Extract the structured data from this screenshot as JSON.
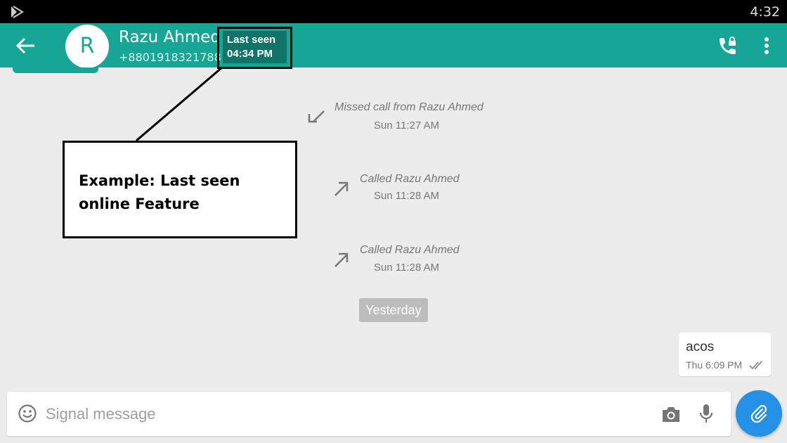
{
  "status_bar": {
    "time": "4:32",
    "icon": "play-store-icon"
  },
  "app_bar": {
    "background_color": "#17a595",
    "avatar_initial": "R",
    "contact_name": "Razu Ahmed",
    "contact_phone": "+8801918321788",
    "last_seen_label": "Last seen",
    "last_seen_time": "04:34 PM",
    "icons": [
      "back-arrow-icon",
      "phone-lock-icon",
      "more-vert-icon"
    ]
  },
  "messages": {
    "call_entries": [
      {
        "type": "missed",
        "icon": "missed-call-icon",
        "title": "Missed call from Razu Ahmed",
        "time": "Sun 11:27 AM"
      },
      {
        "type": "outgoing",
        "icon": "outgoing-call-icon",
        "title": "Called Razu Ahmed",
        "time": "Sun 11:28 AM"
      },
      {
        "type": "outgoing",
        "icon": "outgoing-call-icon",
        "title": "Called Razu Ahmed",
        "time": "Sun 11:28 AM"
      }
    ],
    "date_divider": "Yesterday",
    "outgoing_bubble": {
      "text": "acos",
      "time": "Thu 6:09 PM",
      "status_icon": "double-check-icon"
    }
  },
  "compose": {
    "placeholder": "Signal message",
    "value": "",
    "icons": [
      "emoji-icon",
      "camera-icon",
      "mic-icon",
      "paperclip-icon"
    ],
    "attach_button_color": "#2490e6"
  },
  "annotation": {
    "text": "Example: Last seen online Feature"
  }
}
